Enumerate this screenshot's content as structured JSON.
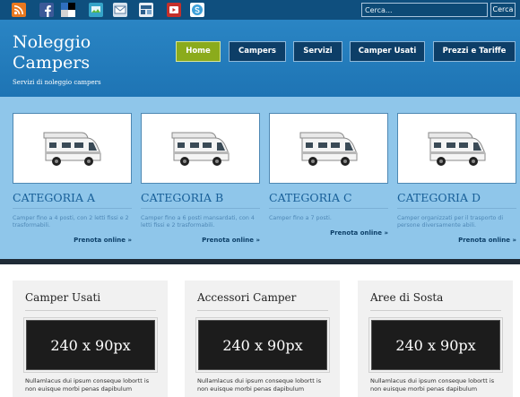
{
  "topbar": {
    "social": [
      {
        "name": "rss-icon",
        "glyph": "",
        "color": "#e9781f"
      },
      {
        "name": "facebook-icon",
        "glyph": "f",
        "color": "#3b5998"
      },
      {
        "name": "delicious-icon",
        "glyph": "",
        "color": "#2f6fbf"
      },
      {
        "name": "share-icon",
        "glyph": "",
        "color": "#35a4c8"
      },
      {
        "name": "email-icon",
        "glyph": "",
        "color": "#5b7ea3"
      },
      {
        "name": "digg-icon",
        "glyph": "",
        "color": "#2c5f8d"
      },
      {
        "name": "youtube-icon",
        "glyph": "",
        "color": "#c4302b"
      },
      {
        "name": "skype-icon",
        "glyph": "",
        "color": "#3da0d9"
      }
    ],
    "search_placeholder": "Cerca...",
    "search_button": "Cerca"
  },
  "header": {
    "title": "Noleggio Campers",
    "subtitle": "Servizi di noleggio campers",
    "nav": [
      {
        "label": "Home",
        "active": true
      },
      {
        "label": "Campers",
        "active": false
      },
      {
        "label": "Servizi",
        "active": false
      },
      {
        "label": "Camper Usati",
        "active": false
      },
      {
        "label": "Prezzi e Tariffe",
        "active": false
      }
    ]
  },
  "categories": [
    {
      "title": "CATEGORIA A",
      "description": "Camper fino a 4 posti, con 2 letti fissi e 2 trasformabili.",
      "link": "Prenota online »"
    },
    {
      "title": "CATEGORIA B",
      "description": "Camper fino a 6 posti mansardati, con 4 letti fissi e 2 trasformabili.",
      "link": "Prenota online »"
    },
    {
      "title": "CATEGORIA C",
      "description": "Camper fino a 7 posti.",
      "link": "Prenota online »"
    },
    {
      "title": "CATEGORIA D",
      "description": "Camper organizzati per il trasporto di persone diversamente abili.",
      "link": "Prenota online »"
    }
  ],
  "cards": [
    {
      "title": "Camper Usati",
      "ad": "240 x 90px",
      "text": "Nullamlacus dui ipsum conseque lobortt is non euisque morbi penas dapibulum"
    },
    {
      "title": "Accessori Camper",
      "ad": "240 x 90px",
      "text": "Nullamlacus dui ipsum conseque lobortt is non euisque morbi penas dapibulum"
    },
    {
      "title": "Aree di Sosta",
      "ad": "240 x 90px",
      "text": "Nullamlacus dui ipsum conseque lobortt is non euisque morbi penas dapibulum"
    }
  ]
}
